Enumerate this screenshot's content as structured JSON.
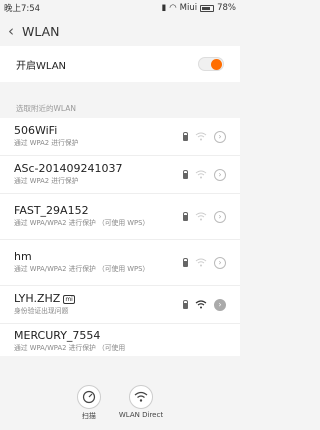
{
  "status_bar": {
    "time": "晚上7:54",
    "carrier": "Miui",
    "battery": "78%"
  },
  "header": {
    "title": "WLAN"
  },
  "wlan_toggle": {
    "label": "开启WLAN",
    "on": true
  },
  "section": {
    "label": "选取附近的WLAN"
  },
  "networks": [
    {
      "name": "506WiFi",
      "sub": "通过 WPA2 进行保护",
      "secured": true,
      "signal": "weak"
    },
    {
      "name": "ASc-201409241037",
      "sub": "通过 WPA2 进行保护",
      "secured": true,
      "signal": "weak"
    },
    {
      "name": "FAST_29A152",
      "sub": "通过 WPA/WPA2 进行保护 （可使用 WPS）",
      "secured": true,
      "signal": "weak"
    },
    {
      "name": "hm",
      "sub": "通过 WPA/WPA2 进行保护 （可使用 WPS）",
      "secured": true,
      "signal": "weak"
    },
    {
      "name": "LYH.ZHZ",
      "badge": "mi",
      "sub": "身份验证出现问题",
      "secured": true,
      "signal": "strong"
    },
    {
      "name": "MERCURY_7554",
      "sub": "通过 WPA/WPA2 进行保护 （可使用",
      "secured": false,
      "signal": "weak"
    }
  ],
  "bottom": {
    "scan_label": "扫描",
    "direct_label": "WLAN Direct"
  },
  "colors": {
    "accent": "#ff6d00",
    "background": "#f4f4f4"
  }
}
